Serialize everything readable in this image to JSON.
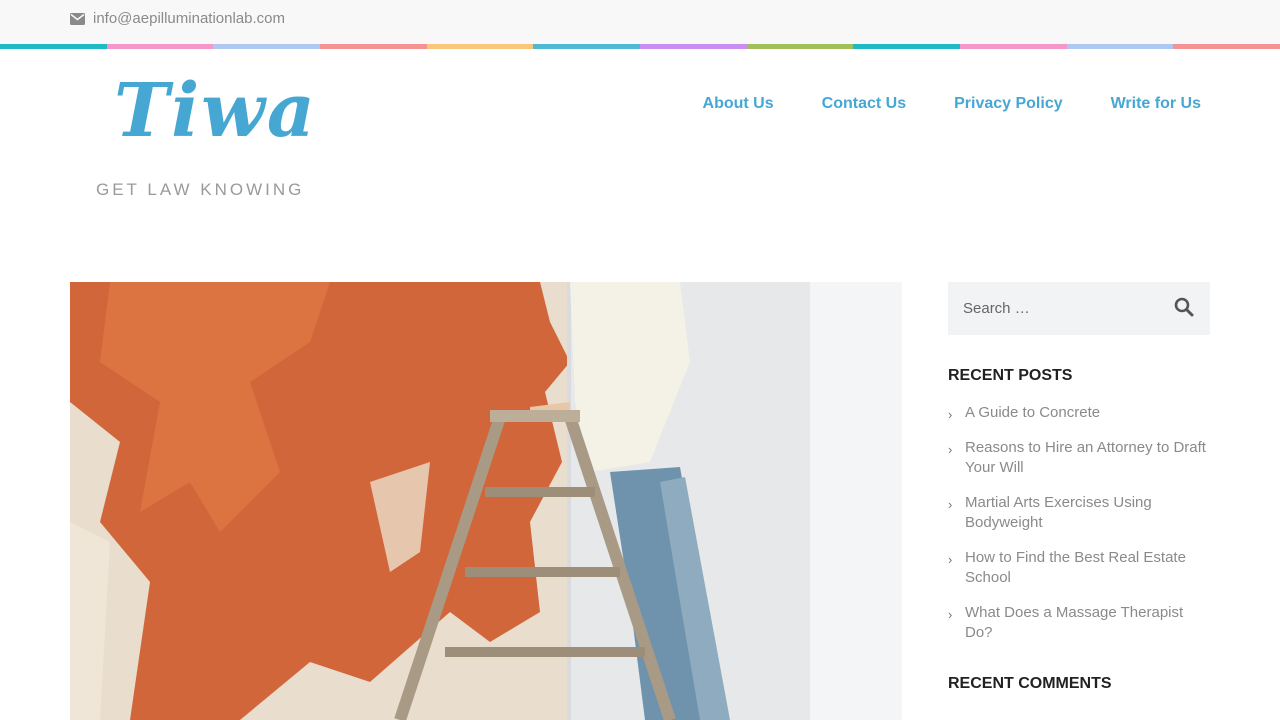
{
  "topbar": {
    "email": "info@aepilluminationlab.com",
    "email_icon": "envelope-icon"
  },
  "stripe_colors": [
    "#1fbac6",
    "#f697c9",
    "#aec7f3",
    "#f39393",
    "#f8c77c",
    "#4fb8d4",
    "#c98ef0",
    "#9fc05a",
    "#1fbac6",
    "#f697c9",
    "#aec7f3",
    "#f39393"
  ],
  "brand": {
    "name": "Tiwa",
    "tagline": "GET LAW KNOWING",
    "color": "#46a7d3"
  },
  "nav": {
    "items": [
      {
        "label": "About Us"
      },
      {
        "label": "Contact Us"
      },
      {
        "label": "Privacy Policy"
      },
      {
        "label": "Write for Us"
      }
    ]
  },
  "search": {
    "placeholder": "Search …",
    "icon": "search-icon"
  },
  "sidebar": {
    "recent_posts_title": "RECENT POSTS",
    "recent_posts": [
      "A Guide to Concrete",
      "Reasons to Hire an Attorney to Draft Your Will",
      "Martial Arts Exercises Using Bodyweight",
      "How to Find the Best Real Estate School",
      "What Does a Massage Therapist Do?"
    ],
    "recent_comments_title": "RECENT COMMENTS"
  }
}
